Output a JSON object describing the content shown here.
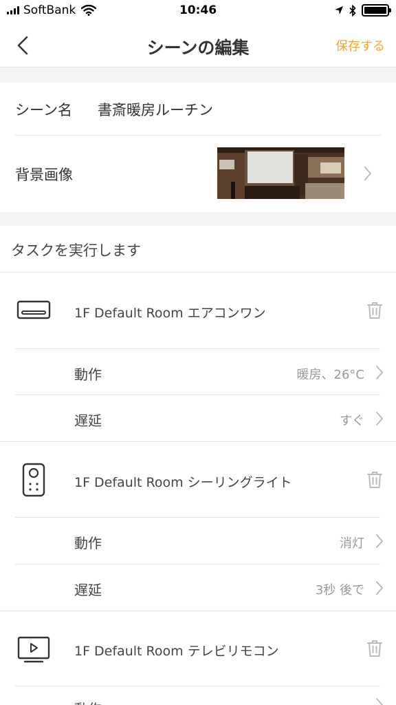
{
  "status_bar": {
    "carrier": "SoftBank",
    "time": "10:46"
  },
  "nav": {
    "title": "シーンの編集",
    "save_label": "保存する",
    "save_color": "#f5a623"
  },
  "scene": {
    "name_label": "シーン名",
    "name_value": "書斎暖房ルーチン",
    "background_label": "背景画像"
  },
  "tasks_header": "タスクを実行します",
  "tasks": [
    {
      "icon": "air-conditioner-icon",
      "device": "1F Default Room エアコンワン",
      "action_label": "動作",
      "action_value": "暖房、26°C",
      "delay_label": "遅延",
      "delay_value": "すぐ"
    },
    {
      "icon": "remote-control-icon",
      "device": "1F Default Room シーリングライト",
      "action_label": "動作",
      "action_value": "消灯",
      "delay_label": "遅延",
      "delay_value": "3秒 後で"
    },
    {
      "icon": "tv-icon",
      "device": "1F Default Room テレビリモコン",
      "action_label": "動作",
      "action_value": ""
    }
  ]
}
